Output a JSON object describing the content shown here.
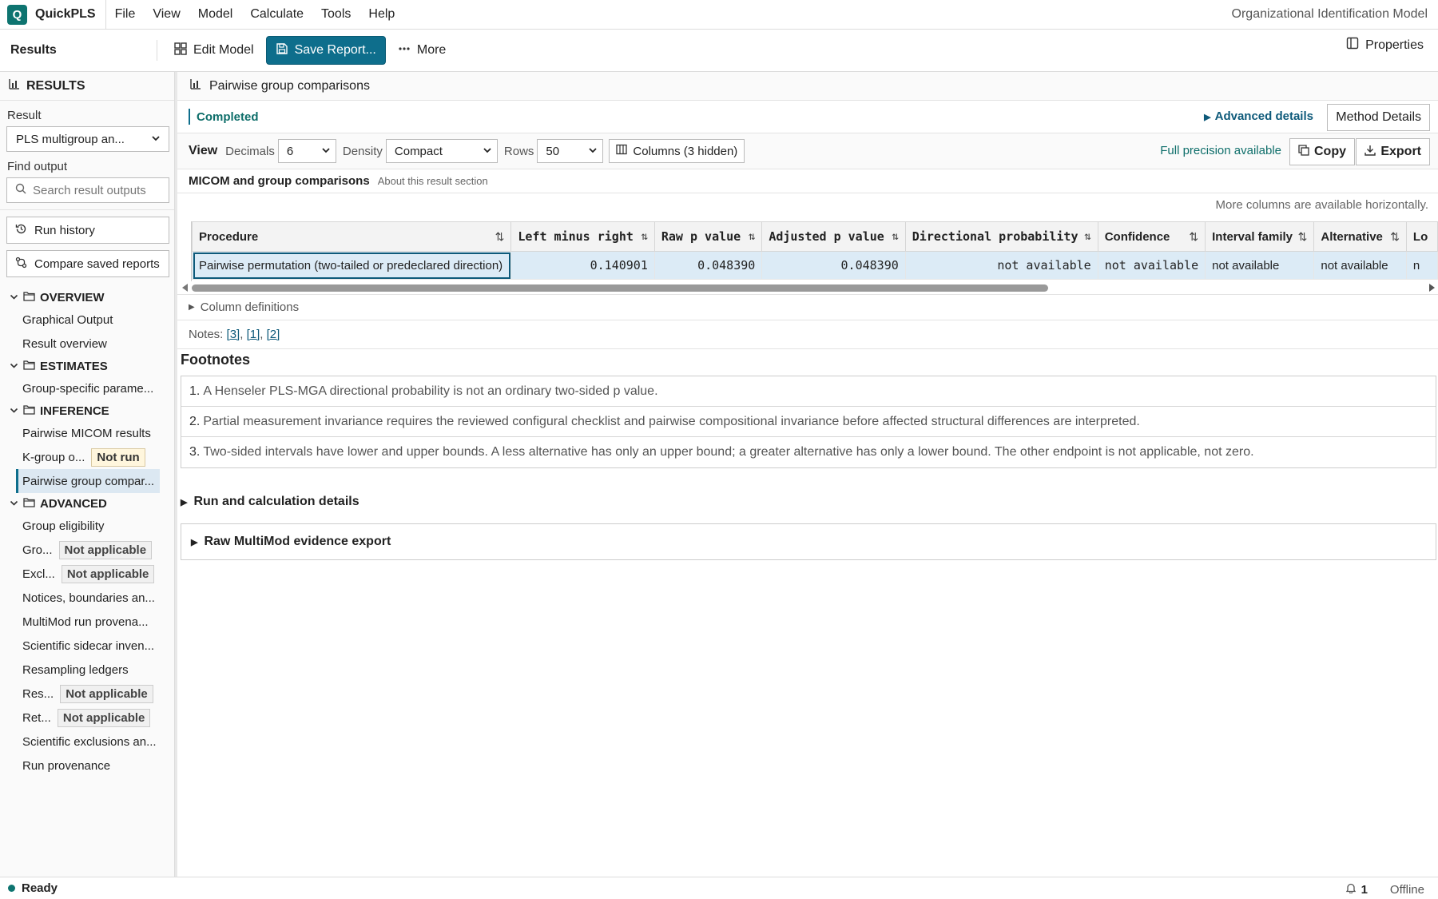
{
  "app": {
    "logo": "Q",
    "name": "QuickPLS",
    "model_title": "Organizational Identification Model"
  },
  "menu": [
    "File",
    "View",
    "Model",
    "Calculate",
    "Tools",
    "Help"
  ],
  "toolbar": {
    "results_label": "Results",
    "edit_model": "Edit Model",
    "save_report": "Save Report...",
    "more": "More",
    "properties": "Properties"
  },
  "sidebar": {
    "header": "RESULTS",
    "result_label": "Result",
    "result_value": "PLS multigroup an...",
    "find_label": "Find output",
    "search_placeholder": "Search result outputs",
    "run_history": "Run history",
    "compare_reports": "Compare saved reports",
    "groups": [
      {
        "title": "OVERVIEW",
        "items": [
          {
            "label": "Graphical Output"
          },
          {
            "label": "Result overview"
          }
        ]
      },
      {
        "title": "ESTIMATES",
        "items": [
          {
            "label": "Group-specific parame..."
          }
        ]
      },
      {
        "title": "INFERENCE",
        "items": [
          {
            "label": "Pairwise MICOM results"
          },
          {
            "label": "K-group o...",
            "badge": "Not run"
          },
          {
            "label": "Pairwise group compar...",
            "active": true
          }
        ]
      },
      {
        "title": "ADVANCED",
        "items": [
          {
            "label": "Group eligibility"
          },
          {
            "label": "Gro...",
            "badge": "Not applicable"
          },
          {
            "label": "Excl...",
            "badge": "Not applicable"
          },
          {
            "label": "Notices, boundaries an..."
          },
          {
            "label": "MultiMod run provena..."
          },
          {
            "label": "Scientific sidecar inven..."
          },
          {
            "label": "Resampling ledgers"
          },
          {
            "label": "Res...",
            "badge": "Not applicable"
          },
          {
            "label": "Ret...",
            "badge": "Not applicable"
          },
          {
            "label": "Scientific exclusions an..."
          },
          {
            "label": "Run provenance"
          }
        ]
      }
    ]
  },
  "main": {
    "panel_title": "Pairwise group comparisons",
    "status": "Completed",
    "advanced_details": "Advanced details",
    "method_details": "Method Details",
    "view": {
      "label": "View",
      "decimals_label": "Decimals",
      "decimals": "6",
      "density_label": "Density",
      "density": "Compact",
      "rows_label": "Rows",
      "rows": "50",
      "columns_btn": "Columns (3 hidden)"
    },
    "full_precision": "Full precision available",
    "copy": "Copy",
    "export": "Export",
    "section_title": "MICOM and group comparisons",
    "section_about": "About this result section",
    "more_columns": "More columns are available horizontally.",
    "table": {
      "headers": [
        "Procedure",
        "Left minus right",
        "Raw p value",
        "Adjusted p value",
        "Directional probability",
        "Confidence",
        "Interval family",
        "Alternative",
        "Lo"
      ],
      "rows": [
        [
          "Pairwise permutation (two-tailed or predeclared direction)",
          "0.140901",
          "0.048390",
          "0.048390",
          "not available",
          "not available",
          "not available",
          "not available",
          "n"
        ]
      ]
    },
    "column_definitions": "Column definitions",
    "notes_label": "Notes:",
    "notes_refs": [
      "[3]",
      "[1]",
      "[2]"
    ],
    "footnotes_title": "Footnotes",
    "footnotes": [
      {
        "n": "1.",
        "text": "A Henseler PLS-MGA directional probability is not an ordinary two-sided p value."
      },
      {
        "n": "2.",
        "text": "Partial measurement invariance requires the reviewed configural checklist and pairwise compositional invariance before affected structural differences are interpreted."
      },
      {
        "n": "3.",
        "text": "Two-sided intervals have lower and upper bounds. A less alternative has only an upper bound; a greater alternative has only a lower bound. The other endpoint is not applicable, not zero."
      }
    ],
    "run_details": "Run and calculation details",
    "raw_export": "Raw MultiMod evidence export"
  },
  "statusbar": {
    "ready": "Ready",
    "notifications": "1",
    "offline": "Offline"
  },
  "colors": {
    "accent": "#0e6e8c",
    "brand": "#0e7470",
    "selected_row": "#dcebf6",
    "badge_not_run": "#fff6dd"
  }
}
